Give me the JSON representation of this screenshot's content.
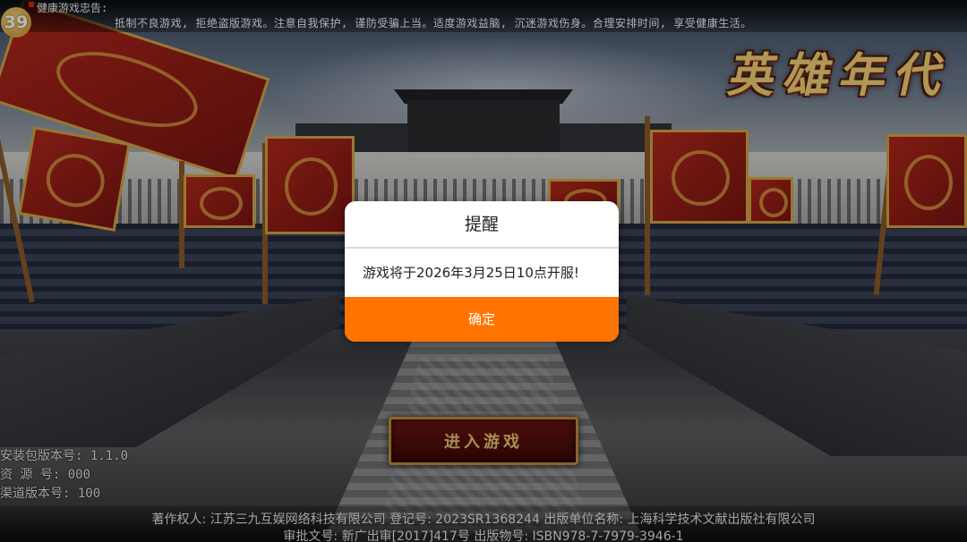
{
  "top_notice": {
    "age_rating": "39",
    "title": "健康游戏忠告:",
    "text": "抵制不良游戏, 拒绝盗版游戏。注意自我保护, 谨防受骗上当。适度游戏益脑, 沉迷游戏伤身。合理安排时间, 享受健康生活。"
  },
  "logo": {
    "text": "英雄年代"
  },
  "dialog": {
    "title": "提醒",
    "message": "游戏将于2026年3月25日10点开服!",
    "confirm_label": "确定",
    "confirm_color": "#ff7300"
  },
  "enter_button": {
    "label": "进入游戏"
  },
  "version_info": {
    "install_version": "安装包版本号: 1.1.0",
    "resource_version": "资 源 号: 000",
    "channel_version": "渠道版本号: 100"
  },
  "footer": {
    "line1": "著作权人: 江苏三九互娱网络科技有限公司 登记号: 2023SR1368244 出版单位名称: 上海科学技术文献出版社有限公司",
    "line2": "审批文号: 新广出审[2017]417号 出版物号: ISBN978-7-7979-3946-1"
  }
}
